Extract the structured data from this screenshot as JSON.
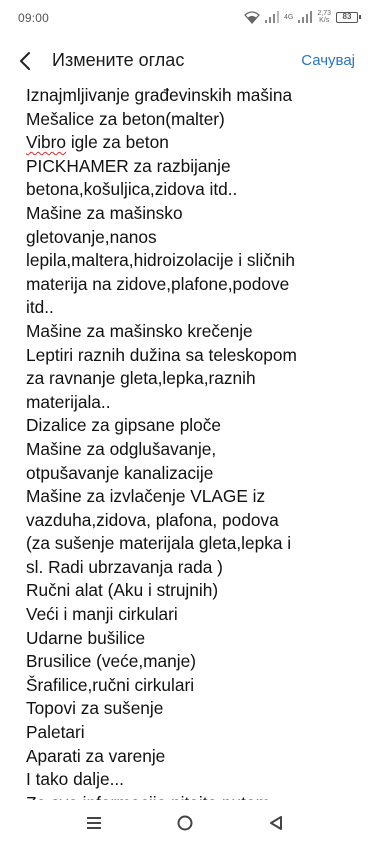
{
  "status_bar": {
    "time": "09:00",
    "network_type": "4G",
    "speed_value": "2,73",
    "speed_unit": "K/s",
    "battery": "83"
  },
  "header": {
    "title": "Измените оглас",
    "save_label": "Сачувај",
    "back_icon": "chevron-left-icon",
    "accent_color": "#2a74c5"
  },
  "content": {
    "lines": [
      "Iznajmljivanje građevinskih mašina",
      "Mešalice za beton(malter)",
      "Vibro",
      " igle za beton",
      "PICKHAMER za razbijanje",
      "betona,košuljica,zidova itd..",
      "Mašine za mašinsko",
      "gletovanje,nanos",
      "lepila,maltera,hidroizolacije i sličnih",
      "materija na zidove,plafone,podove",
      "itd..",
      "Mašine za mašinsko krečenje",
      "Leptiri raznih dužina sa teleskopom",
      "za ravnanje gleta,lepka,raznih",
      "materijala..",
      "Dizalice za gipsane ploče",
      "Mašine za odglušavanje,",
      "otpušavanje kanalizacije",
      "Mašine za izvlačenje VLAGE iz",
      "vazduha,zidova, plafona, podova",
      "(za sušenje materijala gleta,lepka i",
      "sl. Radi ubrzavanja rada )",
      "Ručni alat (Aku i strujnih)",
      "Veći i manji cirkulari",
      "Udarne bušilice",
      "Brusilice (veće,manje)",
      "Šrafilice,ručni cirkulari",
      "Topovi za sušenje",
      "Paletari",
      "Aparati za varenje",
      "I tako dalje...",
      "Za sve informacije pitajte putem"
    ]
  },
  "nav_bar": {
    "menu_icon": "menu-icon",
    "home_icon": "home-circle-icon",
    "back_icon": "back-triangle-icon"
  }
}
